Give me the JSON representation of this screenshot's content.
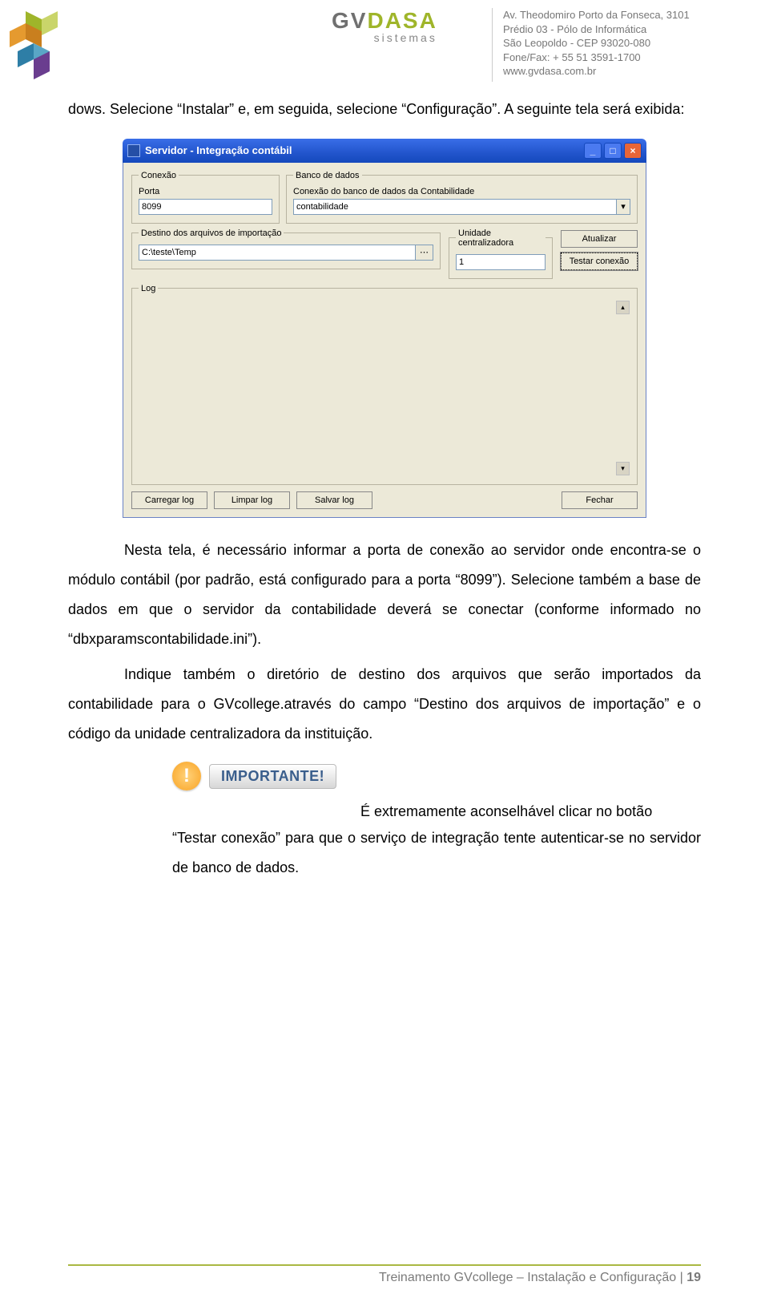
{
  "header": {
    "brand_gv": "GV",
    "brand_dasa": "DASA",
    "brand_sub": "sistemas",
    "addr_l1": "Av. Theodomiro Porto da Fonseca, 3101",
    "addr_l2": "Prédio 03 - Pólo de Informática",
    "addr_l3": "São Leopoldo - CEP 93020-080",
    "addr_l4": "Fone/Fax: + 55 51 3591-1700",
    "addr_l5": "www.gvdasa.com.br"
  },
  "body": {
    "p1": "dows. Selecione “Instalar” e, em seguida, selecione “Configuração”. A seguinte tela será exibida:",
    "p2": "Nesta tela, é necessário informar a porta de conexão ao servidor onde encontra-se o módulo contábil (por padrão, está configurado para a porta “8099”). Selecione também a base de dados em que o servidor da contabilidade deverá se conectar (conforme informado no “dbxparamscontabilidade.ini”).",
    "p3": "Indique também o diretório de destino dos arquivos que serão importados da contabilidade para o GVcollege.através do campo “Destino dos arquivos de importação” e o código da unidade centralizadora da instituição.",
    "p4a": "É extremamente aconselhável clicar no botão",
    "p4b": "“Testar conexão” para que o serviço de integração tente autenticar-se no servidor de banco de dados.",
    "importante": "IMPORTANTE!"
  },
  "win": {
    "title": "Servidor - Integração contábil",
    "conexao_legend": "Conexão",
    "porta_label": "Porta",
    "porta_value": "8099",
    "banco_legend": "Banco de dados",
    "banco_label": "Conexão do banco de dados da Contabilidade",
    "banco_value": "contabilidade",
    "destino_legend": "Destino dos arquivos de importação",
    "destino_value": "C:\\teste\\Temp",
    "unidade_legend": "Unidade centralizadora",
    "unidade_value": "1",
    "btn_atualizar": "Atualizar",
    "btn_testar": "Testar conexão",
    "log_legend": "Log",
    "btn_carregar": "Carregar log",
    "btn_limpar": "Limpar log",
    "btn_salvar": "Salvar log",
    "btn_fechar": "Fechar"
  },
  "footer": {
    "text": "Treinamento GVcollege – Instalação e Configuração | ",
    "page": "19"
  }
}
